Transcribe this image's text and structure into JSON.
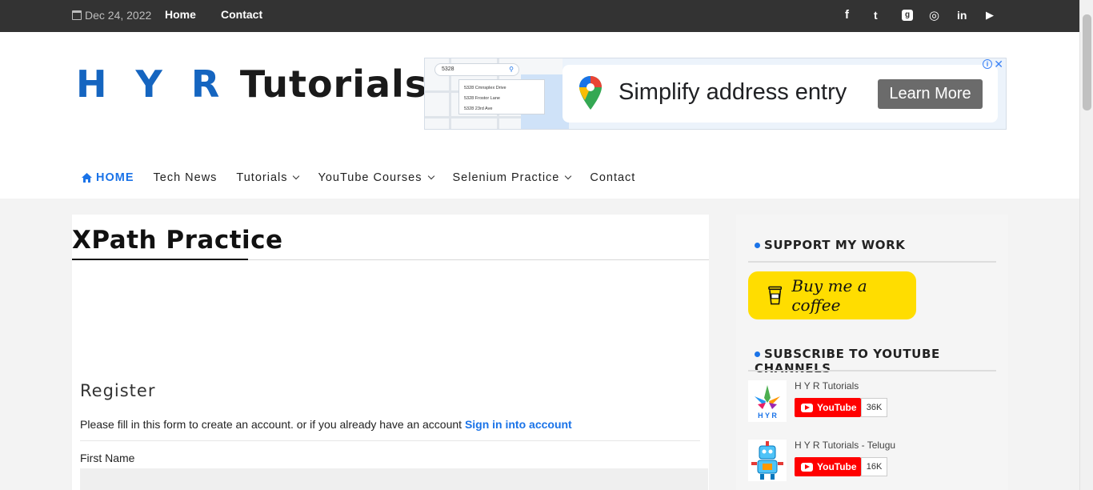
{
  "topbar": {
    "date": "Dec 24, 2022",
    "links": [
      "Home",
      "Contact"
    ],
    "social": [
      "facebook-icon",
      "twitter-icon",
      "github-icon",
      "instagram-icon",
      "linkedin-icon",
      "youtube-icon"
    ],
    "social_glyphs": [
      "f",
      "t",
      "g",
      "◎",
      "in",
      "▶"
    ]
  },
  "logo": {
    "part1": "H Y R",
    "part2": "Tutorials"
  },
  "ad": {
    "search_text": "5328",
    "suggestions": [
      "5328 Cmnsplex Drive",
      "5328 Frostor Lane",
      "5328 23rd Ave"
    ],
    "headline": "Simplify address entry",
    "cta": "Learn More"
  },
  "nav": {
    "items": [
      {
        "label": "HOME"
      },
      {
        "label": "Tech News"
      },
      {
        "label": "Tutorials"
      },
      {
        "label": "YouTube Courses"
      },
      {
        "label": "Selenium Practice"
      },
      {
        "label": "Contact"
      }
    ]
  },
  "main": {
    "title": "XPath Practice",
    "form_heading": "Register",
    "form_desc": "Please fill in this form to create an account. or if you already have an account",
    "signin_link": "Sign in into account",
    "first_name_label": "First Name"
  },
  "sidebar": {
    "support_title": "SUPPORT MY WORK",
    "coffee_label": "Buy me a coffee",
    "subscribe_title": "SUBSCRIBE TO YOUTUBE CHANNELS",
    "channels": [
      {
        "name": "H Y R Tutorials",
        "button": "YouTube",
        "count": "36K"
      },
      {
        "name": "H Y R Tutorials - Telugu",
        "button": "YouTube",
        "count": "16K"
      }
    ]
  },
  "colors": {
    "accent": "#1a73e8",
    "topbar": "#333333",
    "coffee": "#ffdd00",
    "youtube": "#ff0000"
  }
}
